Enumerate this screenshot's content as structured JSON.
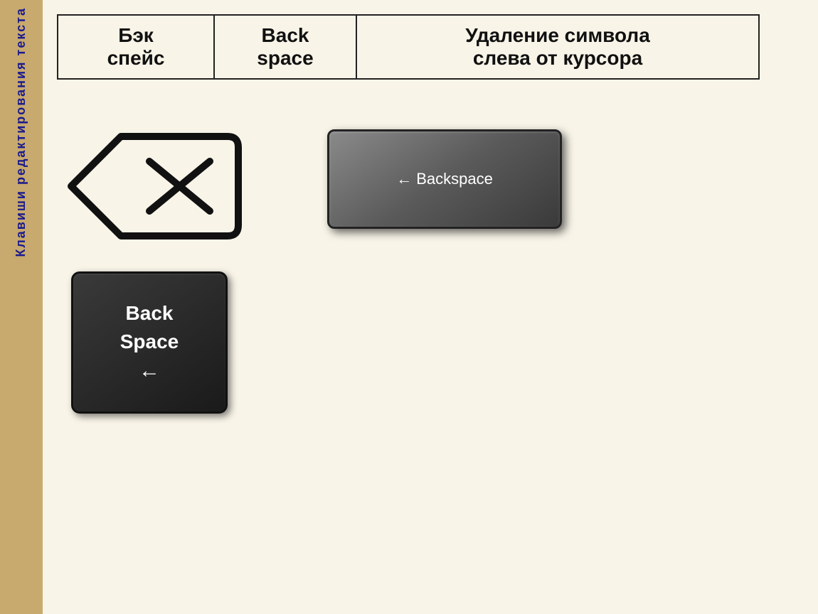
{
  "sidebar": {
    "text": "Клавиши редактирования текста"
  },
  "table": {
    "col1": "Бэк\nспейс",
    "col2": "Back\nspace",
    "col3": "Удаление символа\nслева от курсора"
  },
  "keys": {
    "dark_key_line1": "Back",
    "dark_key_line2": "Space",
    "dark_key_arrow": "←",
    "gray_key_arrow": "←",
    "gray_key_label": "Backspace"
  }
}
